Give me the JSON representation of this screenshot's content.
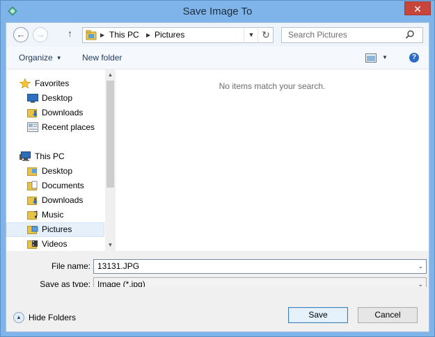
{
  "window": {
    "title": "Save Image To",
    "close_glyph": "✕"
  },
  "address": {
    "back_glyph": "←",
    "forward_glyph": "→",
    "up_glyph": "↑",
    "path": [
      "This PC",
      "Pictures"
    ],
    "chevron_glyph": "▶",
    "dropdown_glyph": "▼",
    "refresh_glyph": "↻"
  },
  "search": {
    "placeholder": "Search Pictures"
  },
  "toolbar": {
    "organize_label": "Organize",
    "new_folder_label": "New folder",
    "help_glyph": "?"
  },
  "nav": {
    "items": [
      {
        "label": "Favorites",
        "icon": "star-icon",
        "indent": 1
      },
      {
        "label": "Desktop",
        "icon": "desktop-icon",
        "indent": 2
      },
      {
        "label": "Downloads",
        "icon": "downloads-folder-icon",
        "indent": 2
      },
      {
        "label": "Recent places",
        "icon": "recent-places-icon",
        "indent": 2
      },
      {
        "label": "This PC",
        "icon": "computer-icon",
        "indent": 1
      },
      {
        "label": "Desktop",
        "icon": "folder-icon",
        "indent": 2
      },
      {
        "label": "Documents",
        "icon": "documents-folder-icon",
        "indent": 2
      },
      {
        "label": "Downloads",
        "icon": "downloads-folder-icon",
        "indent": 2
      },
      {
        "label": "Music",
        "icon": "music-folder-icon",
        "indent": 2
      },
      {
        "label": "Pictures",
        "icon": "pictures-folder-icon",
        "indent": 2,
        "selected": true
      },
      {
        "label": "Videos",
        "icon": "videos-folder-icon",
        "indent": 2
      }
    ],
    "scroll_up_glyph": "▲",
    "scroll_down_glyph": "▼"
  },
  "content": {
    "empty_message": "No items match your search."
  },
  "form": {
    "filename_label": "File name:",
    "filename_value": "13131.JPG",
    "filetype_label": "Save as type:",
    "filetype_value": "Image (*.jpg)",
    "dropdown_glyph": "⌄"
  },
  "footer": {
    "hide_folders_label": "Hide Folders",
    "hide_glyph": "▲",
    "save_label": "Save",
    "cancel_label": "Cancel"
  },
  "colors": {
    "frame": "#7eb4ea",
    "close": "#c7453a",
    "selection": "#e5f0fb"
  }
}
